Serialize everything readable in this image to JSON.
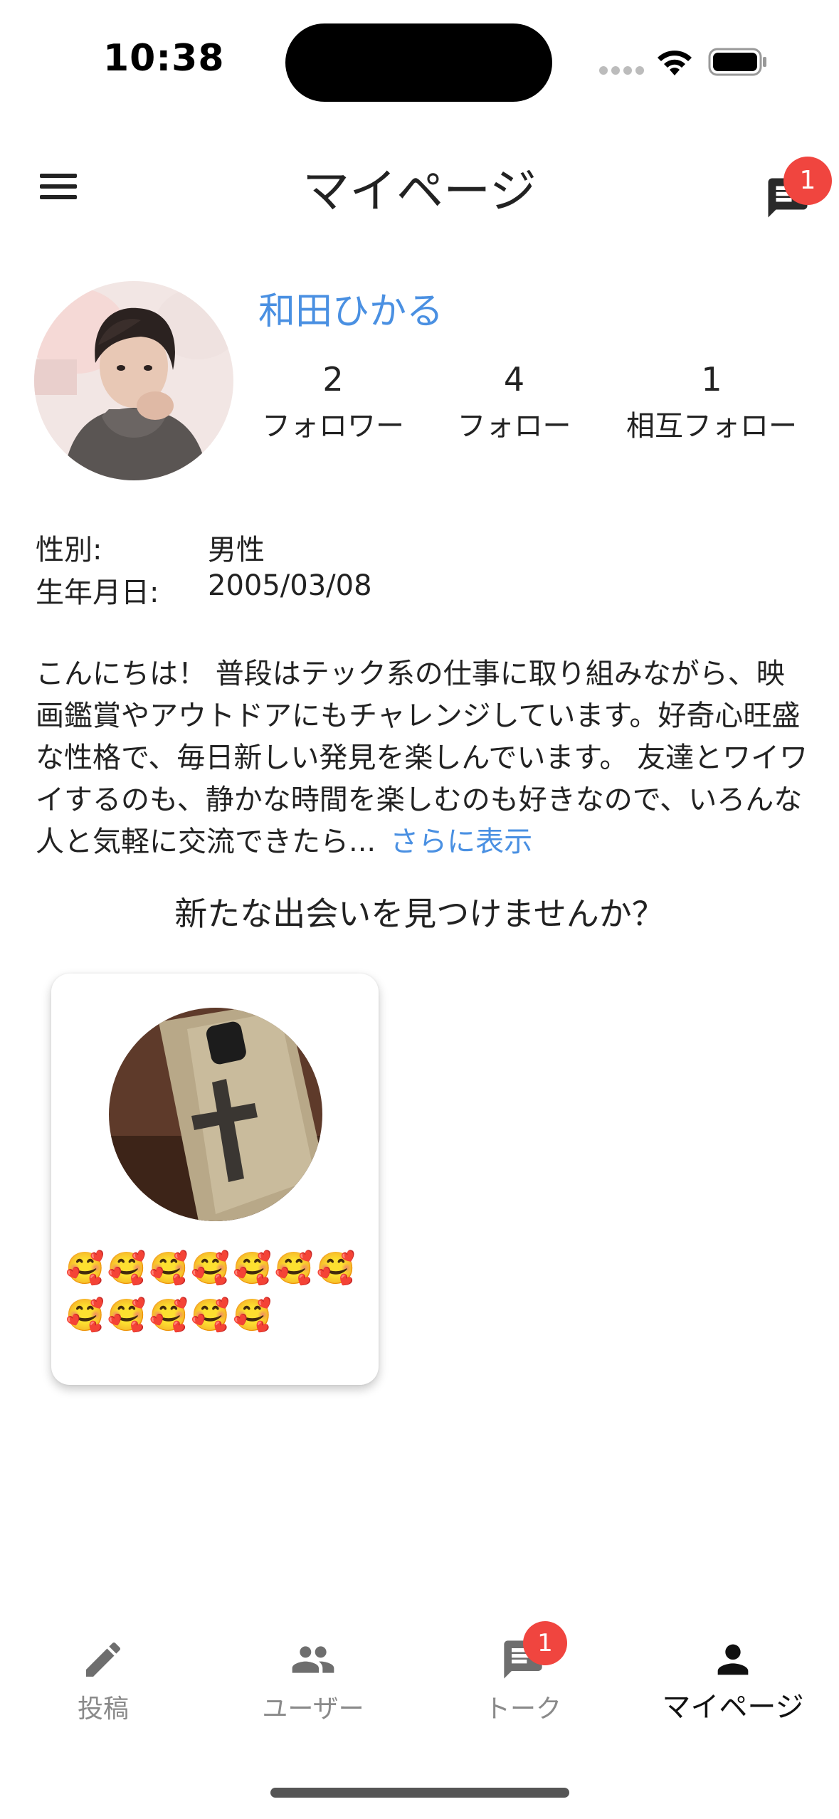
{
  "status_bar": {
    "time": "10:38"
  },
  "header": {
    "title": "マイページ",
    "message_badge": "1"
  },
  "profile": {
    "name": "和田ひかる",
    "stats": [
      {
        "count": "2",
        "label": "フォロワー"
      },
      {
        "count": "4",
        "label": "フォロー"
      },
      {
        "count": "1",
        "label": "相互フォロー"
      }
    ],
    "gender_label": "性別:",
    "gender_value": "男性",
    "birthday_label": "生年月日:",
    "birthday_value": "2005/03/08",
    "bio": "こんにちは！ 普段はテック系の仕事に取り組みながら、映画鑑賞やアウトドアにもチャレンジしています。好奇心旺盛な性格で、毎日新しい発見を楽しんでいます。 友達とワイワイするのも、静かな時間を楽しむのも好きなので、いろんな人と気軽に交流できたら...",
    "show_more": "さらに表示"
  },
  "discover_heading": "新たな出会いを見つけませんか？",
  "post_card": {
    "text": "🥰🥰🥰🥰🥰🥰🥰🥰🥰🥰🥰🥰"
  },
  "bottom_nav": {
    "items": [
      {
        "label": "投稿",
        "icon": "pencil-icon"
      },
      {
        "label": "ユーザー",
        "icon": "users-icon"
      },
      {
        "label": "トーク",
        "icon": "chat-icon",
        "badge": "1"
      },
      {
        "label": "マイページ",
        "icon": "person-icon",
        "active": true
      }
    ]
  },
  "colors": {
    "accent_link": "#4a90e2",
    "badge": "#f0453f",
    "inactive_nav": "#8a8a8a",
    "active_nav": "#111111"
  }
}
